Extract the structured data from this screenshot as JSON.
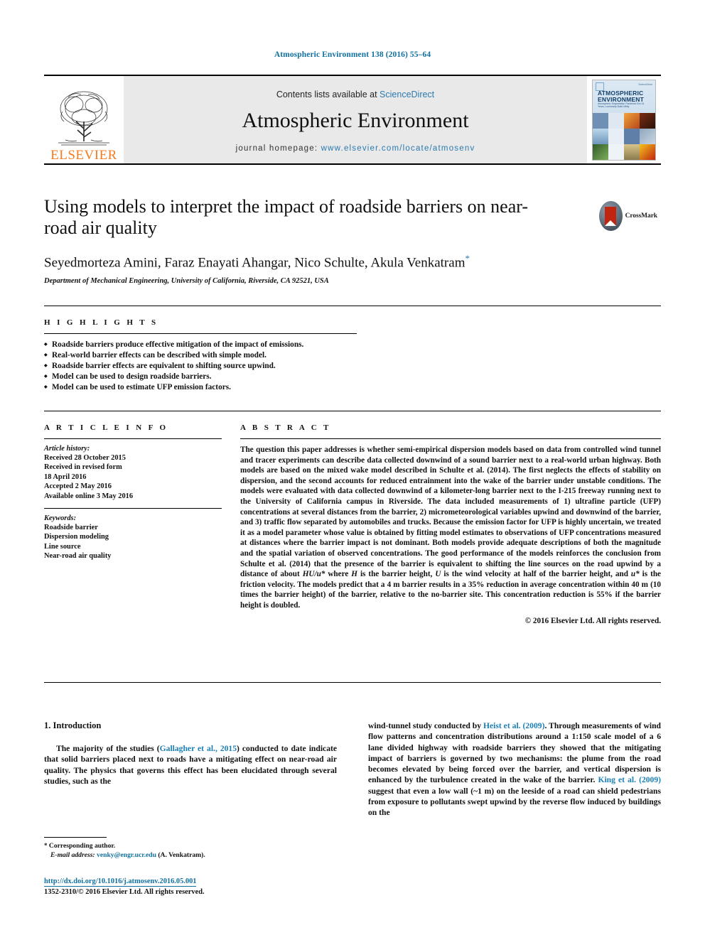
{
  "running_head": "Atmospheric Environment 138 (2016) 55–64",
  "masthead": {
    "publisher": "ELSEVIER",
    "contents_prefix": "Contents lists available at",
    "contents_link": "ScienceDirect",
    "journal_title": "Atmospheric Environment",
    "homepage_label": "journal homepage:",
    "homepage_url": "www.elsevier.com/locate/atmosenv",
    "cover": {
      "line1": "ATMOSPHERIC",
      "line2": "ENVIRONMENT",
      "subtitle": "Atmospheric Degradation Pandemic Era 14 Years, Luminosity Build Utility",
      "sciencedirect_tag": "ScienceDirect"
    }
  },
  "article": {
    "title": "Using models to interpret the impact of roadside barriers on near-road air quality",
    "authors": "Seyedmorteza Amini, Faraz Enayati Ahangar, Nico Schulte, Akula Venkatram",
    "author_star": "*",
    "affiliation": "Department of Mechanical Engineering, University of California, Riverside, CA 92521, USA",
    "crossmark_label": "CrossMark"
  },
  "highlights": {
    "label": "H I G H L I G H T S",
    "items": [
      "Roadside barriers produce effective mitigation of the impact of emissions.",
      "Real-world barrier effects can be described with simple model.",
      "Roadside barrier effects are equivalent to shifting source upwind.",
      "Model can be used to design roadside barriers.",
      "Model can be used to estimate UFP emission factors."
    ]
  },
  "article_info": {
    "label": "A R T I C L E   I N F O",
    "history_label": "Article history:",
    "history": [
      "Received 28 October 2015",
      "Received in revised form",
      "18 April 2016",
      "Accepted 2 May 2016",
      "Available online 3 May 2016"
    ],
    "keywords_label": "Keywords:",
    "keywords": [
      "Roadside barrier",
      "Dispersion modeling",
      "Line source",
      "Near-road air quality"
    ]
  },
  "abstract": {
    "label": "A B S T R A C T",
    "part1": "The question this paper addresses is whether semi-empirical dispersion models based on data from controlled wind tunnel and tracer experiments can describe data collected downwind of a sound barrier next to a real-world urban highway. Both models are based on the mixed wake model described in Schulte et al. (2014). The first neglects the effects of stability on dispersion, and the second accounts for reduced entrainment into the wake of the barrier under unstable conditions. The models were evaluated with data collected downwind of a kilometer-long barrier next to the I-215 freeway running next to the University of California campus in Riverside. The data included measurements of 1) ultrafine particle (UFP) concentrations at several distances from the barrier, 2) micrometeorological variables upwind and downwind of the barrier, and 3) traffic flow separated by automobiles and trucks. Because the emission factor for UFP is highly uncertain, we treated it as a model parameter whose value is obtained by fitting model estimates to observations of UFP concentrations measured at distances where the barrier impact is not dominant. Both models provide adequate descriptions of both the magnitude and the spatial variation of observed concentrations. The good performance of the models reinforces the conclusion from Schulte et al. (2014) that the presence of the barrier is equivalent to shifting the line sources on the road upwind by a distance of about ",
    "math1": "HU/u*",
    "part2": " where ",
    "math2": "H",
    "part3": " is the barrier height, ",
    "math3": "U",
    "part4": " is the wind velocity at half of the barrier height, and ",
    "math4": "u*",
    "part5": " is the friction velocity. The models predict that a 4 m barrier results in a 35% reduction in average concentration within 40 m (10 times the barrier height) of the barrier, relative to the no-barrier site. This concentration reduction is 55% if the barrier height is doubled.",
    "copyright": "© 2016 Elsevier Ltd. All rights reserved."
  },
  "introduction": {
    "heading": "1. Introduction",
    "left_pre": "The majority of the studies (",
    "left_cite": "Gallagher et al., 2015",
    "left_post": ") conducted to date indicate that solid barriers placed next to roads have a mitigating effect on near-road air quality. The physics that governs this effect has been elucidated through several studies, such as the",
    "right_pre": "wind-tunnel study conducted by ",
    "right_cite1": "Heist et al. (2009)",
    "right_mid": ". Through measurements of wind flow patterns and concentration distributions around a 1:150 scale model of a 6 lane divided highway with roadside barriers they showed that the mitigating impact of barriers is governed by two mechanisms: the plume from the road becomes elevated by being forced over the barrier, and vertical dispersion is enhanced by the turbulence created in the wake of the barrier. ",
    "right_cite2": "King et al. (2009)",
    "right_post": " suggest that even a low wall (~1 m) on the leeside of a road can shield pedestrians from exposure to pollutants swept upwind by the reverse flow induced by buildings on the"
  },
  "footer": {
    "corresponding_star": "*",
    "corresponding_label": " Corresponding author.",
    "email_label": "E-mail address:",
    "email": "venky@engr.ucr.edu",
    "email_suffix": " (A. Venkatram).",
    "doi": "http://dx.doi.org/10.1016/j.atmosenv.2016.05.001",
    "issn": "1352-2310/© 2016 Elsevier Ltd. All rights reserved."
  },
  "colors": {
    "link_blue": "#1070a0",
    "cite_blue": "#1a7fb5",
    "elsevier_orange": "#f47c20",
    "crossmark_red": "#c0260f"
  }
}
